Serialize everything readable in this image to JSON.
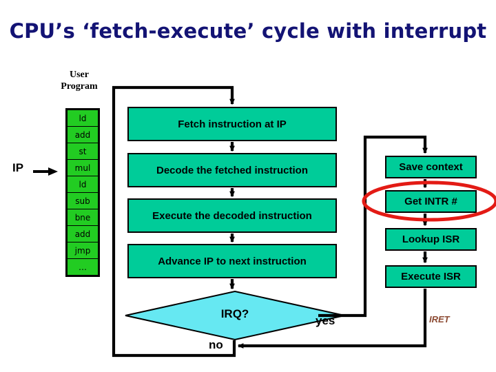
{
  "slide": {
    "title": "CPU’s ‘fetch-execute’ cycle with interrupt",
    "title_color": "#131374",
    "background": "#ffffff"
  },
  "user_program": {
    "label_line1": "User",
    "label_line2": "Program",
    "pointer_label": "IP",
    "pointer_icon": "right-arrow-icon",
    "cell_color": "#22cc22",
    "instructions": [
      "ld",
      "add",
      "st",
      "mul",
      "ld",
      "sub",
      "bne",
      "add",
      "jmp",
      "…"
    ],
    "pointer_target_index": 3
  },
  "main_flow": {
    "box_color": "#00cc99",
    "steps": [
      "Fetch instruction at IP",
      "Decode the fetched instruction",
      "Execute the decoded instruction",
      "Advance IP to next instruction"
    ],
    "decision": "IRQ?",
    "decision_color": "#66e8f2",
    "branch_yes": "yes",
    "branch_no": "no"
  },
  "interrupt_flow": {
    "box_color": "#00cc99",
    "steps": [
      "Save context",
      "Get INTR #",
      "Lookup ISR",
      "Execute ISR"
    ],
    "return_label": "IRET",
    "return_label_color": "#8c4a32",
    "highlight_color": "#e31b15",
    "highlighted_step_index": 1
  }
}
